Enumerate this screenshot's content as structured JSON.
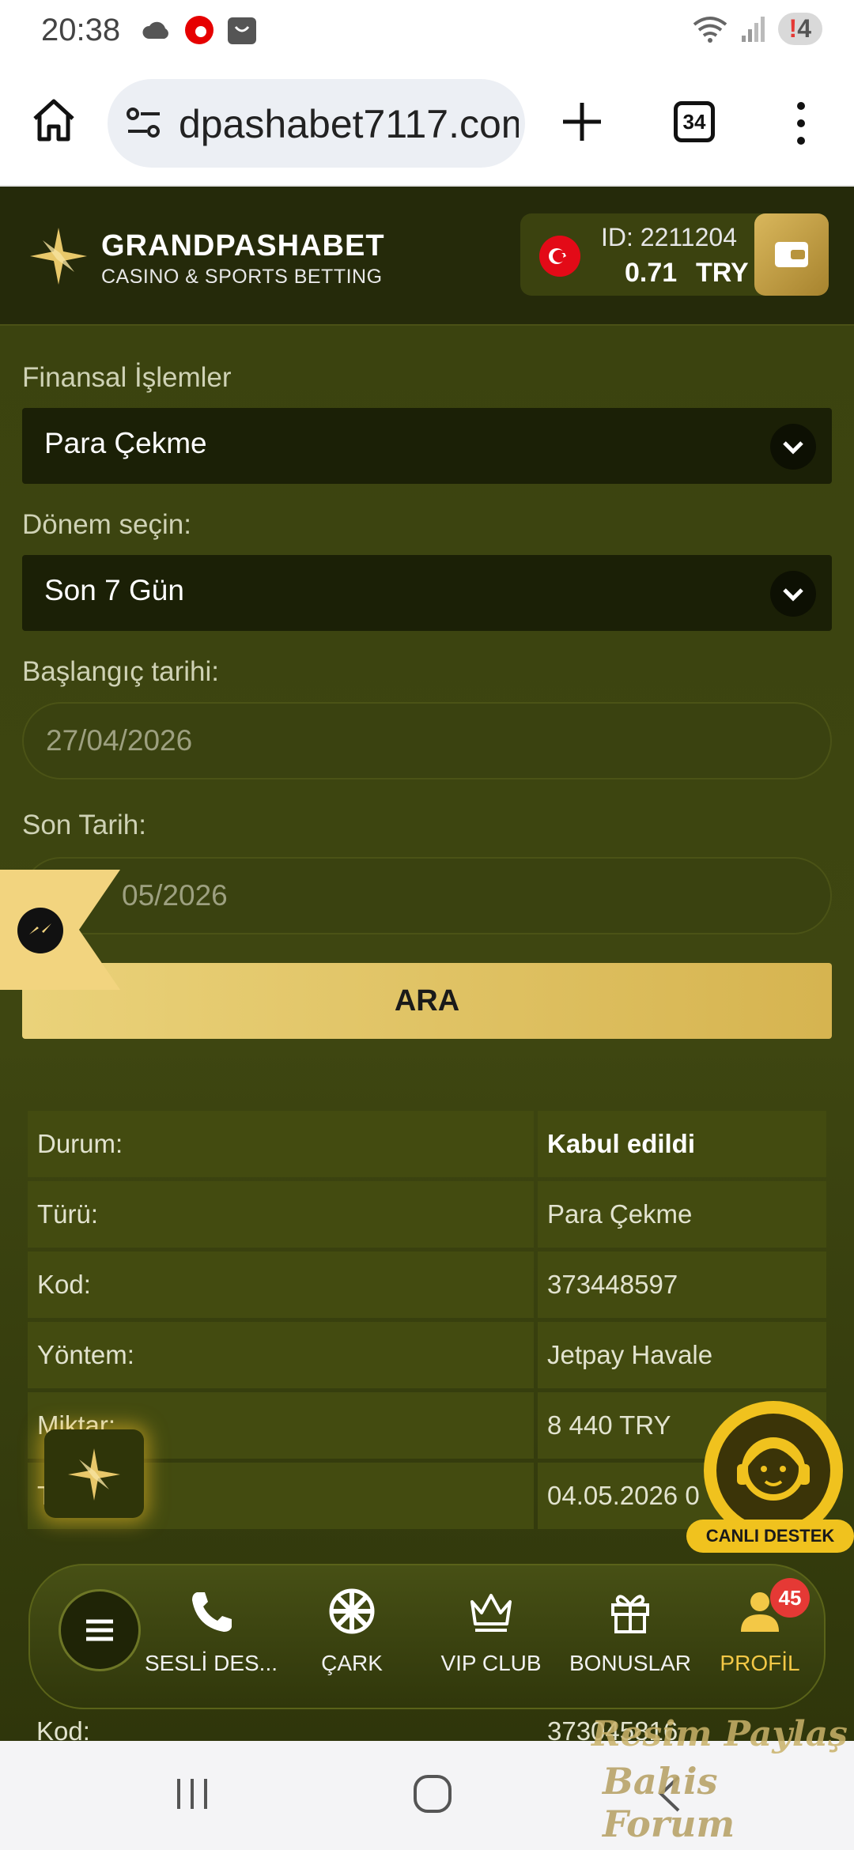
{
  "status_bar": {
    "time": "20:38",
    "notification_count": "4",
    "wifi_label": "5"
  },
  "browser": {
    "url": "dpashabet7117.com",
    "tab_count": "34"
  },
  "header": {
    "brand_name": "GRANDPASHABET",
    "brand_sub": "CASINO & SPORTS BETTING",
    "account_id": "ID: 2211204",
    "balance": "0.71",
    "currency": "TRY"
  },
  "filters": {
    "financial_label": "Finansal İşlemler",
    "financial_value": "Para Çekme",
    "period_label": "Dönem seçin:",
    "period_value": "Son 7 Gün",
    "start_label": "Başlangıç tarihi:",
    "start_value": "27/04/2026",
    "end_label": "Son Tarih:",
    "end_value": "05/2026",
    "search_label": "ARA"
  },
  "transaction": {
    "rows": [
      {
        "label": "Durum:",
        "value": "Kabul edildi"
      },
      {
        "label": "Türü:",
        "value": "Para Çekme"
      },
      {
        "label": "Kod:",
        "value": "373448597"
      },
      {
        "label": "Yöntem:",
        "value": "Jetpay Havale"
      },
      {
        "label": "Miktar:",
        "value": "8 440 TRY"
      },
      {
        "label": "T",
        "value": "04.05.2026 0"
      }
    ],
    "next_row": {
      "label": "Kod:",
      "value": "373045816"
    }
  },
  "live_support": {
    "label": "CANLI DESTEK"
  },
  "bottom_nav": {
    "items": [
      {
        "label": "SESLİ DES..."
      },
      {
        "label": "ÇARK"
      },
      {
        "label": "VIP CLUB"
      },
      {
        "label": "BONUSLAR"
      },
      {
        "label": "PROFİL"
      }
    ],
    "profile_badge": "45"
  },
  "watermark": {
    "line1": "Resim Paylaş",
    "line2": "Bahis Forum"
  }
}
